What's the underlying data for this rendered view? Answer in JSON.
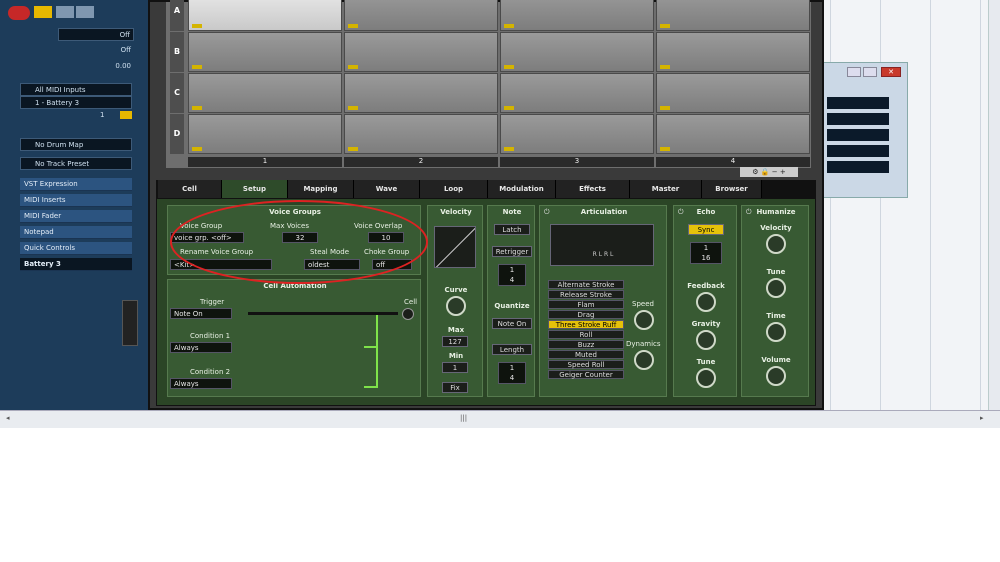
{
  "inspector": {
    "fields": [
      {
        "label": "Off"
      },
      {
        "label": "Off"
      },
      {
        "label": "0.00"
      }
    ],
    "midi_input": "All MIDI Inputs",
    "midi_output": "1 - Battery 3",
    "channel": "1",
    "drum_map": "No Drum Map",
    "track_preset": "No Track Preset",
    "sections": [
      "VST Expression",
      "MIDI Inserts",
      "MIDI Fader",
      "Notepad",
      "Quick Controls"
    ],
    "track_name": "Battery 3"
  },
  "battery": {
    "rows": [
      "A",
      "B",
      "C",
      "D"
    ],
    "columns": [
      "1",
      "2",
      "3",
      "4"
    ],
    "tabs": [
      "Cell",
      "Setup",
      "Mapping",
      "Wave",
      "Loop",
      "Modulation",
      "Effects",
      "Master",
      "Browser"
    ],
    "selected_tab": "Setup",
    "voice_groups": {
      "title": "Voice Groups",
      "voice_group_label": "Voice Group",
      "voice_group_value": "voice grp. <off>",
      "max_voices_label": "Max Voices",
      "max_voices_value": "32",
      "voice_overlap_label": "Voice Overlap",
      "voice_overlap_value": "10",
      "rename_label": "Rename Voice Group",
      "rename_value": "<Kit>",
      "steal_mode_label": "Steal Mode",
      "steal_mode_value": "oldest",
      "choke_group_label": "Choke Group",
      "choke_group_value": "off"
    },
    "cell_automation": {
      "title": "Cell Automation",
      "trigger_label": "Trigger",
      "trigger_value": "Note On",
      "cell_label": "Cell",
      "cond1_label": "Condition 1",
      "cond1_value": "Always",
      "cond2_label": "Condition 2",
      "cond2_value": "Always"
    },
    "velocity": {
      "title": "Velocity",
      "curve": "Curve",
      "max_label": "Max",
      "max_value": "127",
      "min_label": "Min",
      "min_value": "1",
      "fix": "Fix"
    },
    "note": {
      "title": "Note",
      "latch": "Latch",
      "retrigger": "Retrigger",
      "retrig_num": "1",
      "retrig_den": "4",
      "quantize": "Quantize",
      "note_on": "Note On",
      "length": "Length",
      "len_num": "1",
      "len_den": "4"
    },
    "articulation": {
      "title": "Articulation",
      "notation": "R L R L",
      "items": [
        "Alternate Stroke",
        "Release Stroke",
        "Flam",
        "Drag",
        "Three Stroke Ruff",
        "Roll",
        "Buzz",
        "Muted",
        "Speed Roll",
        "Geiger Counter"
      ],
      "selected": "Three Stroke Ruff",
      "speed": "Speed",
      "dynamics": "Dynamics"
    },
    "echo": {
      "title": "Echo",
      "sync": "Sync",
      "num": "1",
      "den": "16",
      "feedback": "Feedback",
      "gravity": "Gravity",
      "tune": "Tune"
    },
    "humanize": {
      "title": "Humanize",
      "velocity": "Velocity",
      "tune": "Tune",
      "time": "Time",
      "volume": "Volume"
    }
  },
  "colors": {
    "panel": "#2b4526",
    "highlight": "#e6c20a",
    "annotation": "#dd2222"
  }
}
